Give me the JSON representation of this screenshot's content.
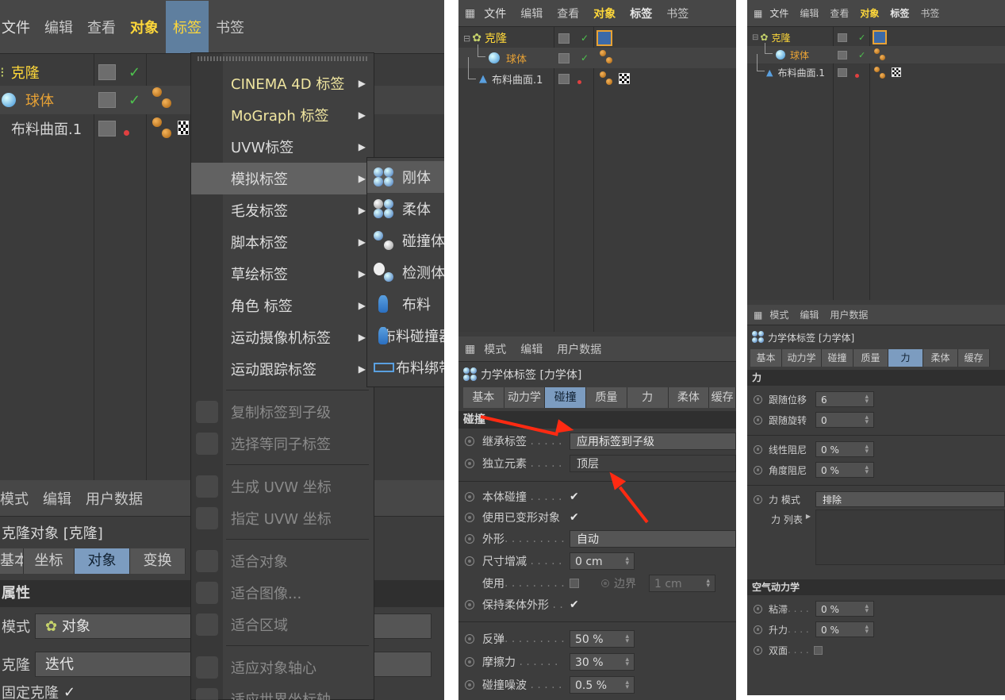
{
  "panel1": {
    "menubar": [
      "文件",
      "编辑",
      "查看",
      "对象",
      "标签",
      "书签"
    ],
    "objects": [
      "克隆",
      "球体",
      "布料曲面.1"
    ],
    "tag_menu": {
      "items": [
        "CINEMA 4D 标签",
        "MoGraph 标签",
        "UVW标签",
        "模拟标签",
        "毛发标签",
        "脚本标签",
        "草绘标签",
        "角色 标签",
        "运动摄像机标签",
        "运动跟踪标签"
      ],
      "disabled": [
        "复制标签到子级",
        "选择等同子标签",
        "生成 UVW 坐标",
        "指定 UVW 坐标",
        "适合对象",
        "适合图像...",
        "适合区域",
        "适应对象轴心",
        "适应世界坐标轴"
      ]
    },
    "sim_submenu": [
      "刚体",
      "柔体",
      "碰撞体",
      "检测体",
      "布料",
      "布料碰撞器",
      "布料绑带"
    ],
    "attr": {
      "menubar": [
        "模式",
        "编辑",
        "用户数据"
      ],
      "title": "克隆对象 [克隆]",
      "tabs": [
        "基本",
        "坐标",
        "对象",
        "变换"
      ],
      "section": "属性",
      "mode_label": "模式",
      "mode_value": "对象",
      "clone_label": "克隆",
      "clone_value": "迭代",
      "fixed_label": "固定克隆"
    }
  },
  "panel2": {
    "menubar": [
      "文件",
      "编辑",
      "查看",
      "对象",
      "标签",
      "书签"
    ],
    "objects": [
      "克隆",
      "球体",
      "布料曲面.1"
    ],
    "attr": {
      "menubar": [
        "模式",
        "编辑",
        "用户数据"
      ],
      "title": "力学体标签 [力学体]",
      "tabs": [
        "基本",
        "动力学",
        "碰撞",
        "质量",
        "力",
        "柔体",
        "缓存"
      ],
      "section": "碰撞",
      "inherit_label": "继承标签",
      "inherit_value": "应用标签到子级",
      "standalone_label": "独立元素",
      "standalone_value": "顶层",
      "self_label": "本体碰撞",
      "deformed_label": "使用已变形对象",
      "shape_label": "外形",
      "shape_value": "自动",
      "size_label": "尺寸增减",
      "size_value": "0 cm",
      "use_label": "使用",
      "border_label": "边界",
      "border_value": "1 cm",
      "keep_label": "保持柔体外形",
      "bounce_label": "反弹",
      "bounce_value": "50 %",
      "friction_label": "摩擦力",
      "friction_value": "30 %",
      "noise_label": "碰撞噪波",
      "noise_value": "0.5 %"
    }
  },
  "panel3": {
    "menubar": [
      "文件",
      "编辑",
      "查看",
      "对象",
      "标签",
      "书签"
    ],
    "objects": [
      "克隆",
      "球体",
      "布料曲面.1"
    ],
    "attr": {
      "menubar": [
        "模式",
        "编辑",
        "用户数据"
      ],
      "title": "力学体标签 [力学体]",
      "tabs": [
        "基本",
        "动力学",
        "碰撞",
        "质量",
        "力",
        "柔体",
        "缓存"
      ],
      "section": "力",
      "follow_pos_label": "跟随位移",
      "follow_pos_value": "6",
      "follow_rot_label": "跟随旋转",
      "follow_rot_value": "0",
      "linear_label": "线性阻尼",
      "linear_value": "0 %",
      "angular_label": "角度阻尼",
      "angular_value": "0 %",
      "force_mode_label": "力 模式",
      "force_mode_value": "排除",
      "force_list_label": "力 列表",
      "aero_section": "空气动力学",
      "drag_label": "粘滞",
      "drag_value": "0 %",
      "lift_label": "升力",
      "lift_value": "0 %",
      "two_sided_label": "双面"
    }
  },
  "colors": {
    "highlight": "#ffd83a",
    "orange": "#e8a235",
    "tab_active": "#7c9cc0",
    "arrow": "#ff2a12"
  }
}
